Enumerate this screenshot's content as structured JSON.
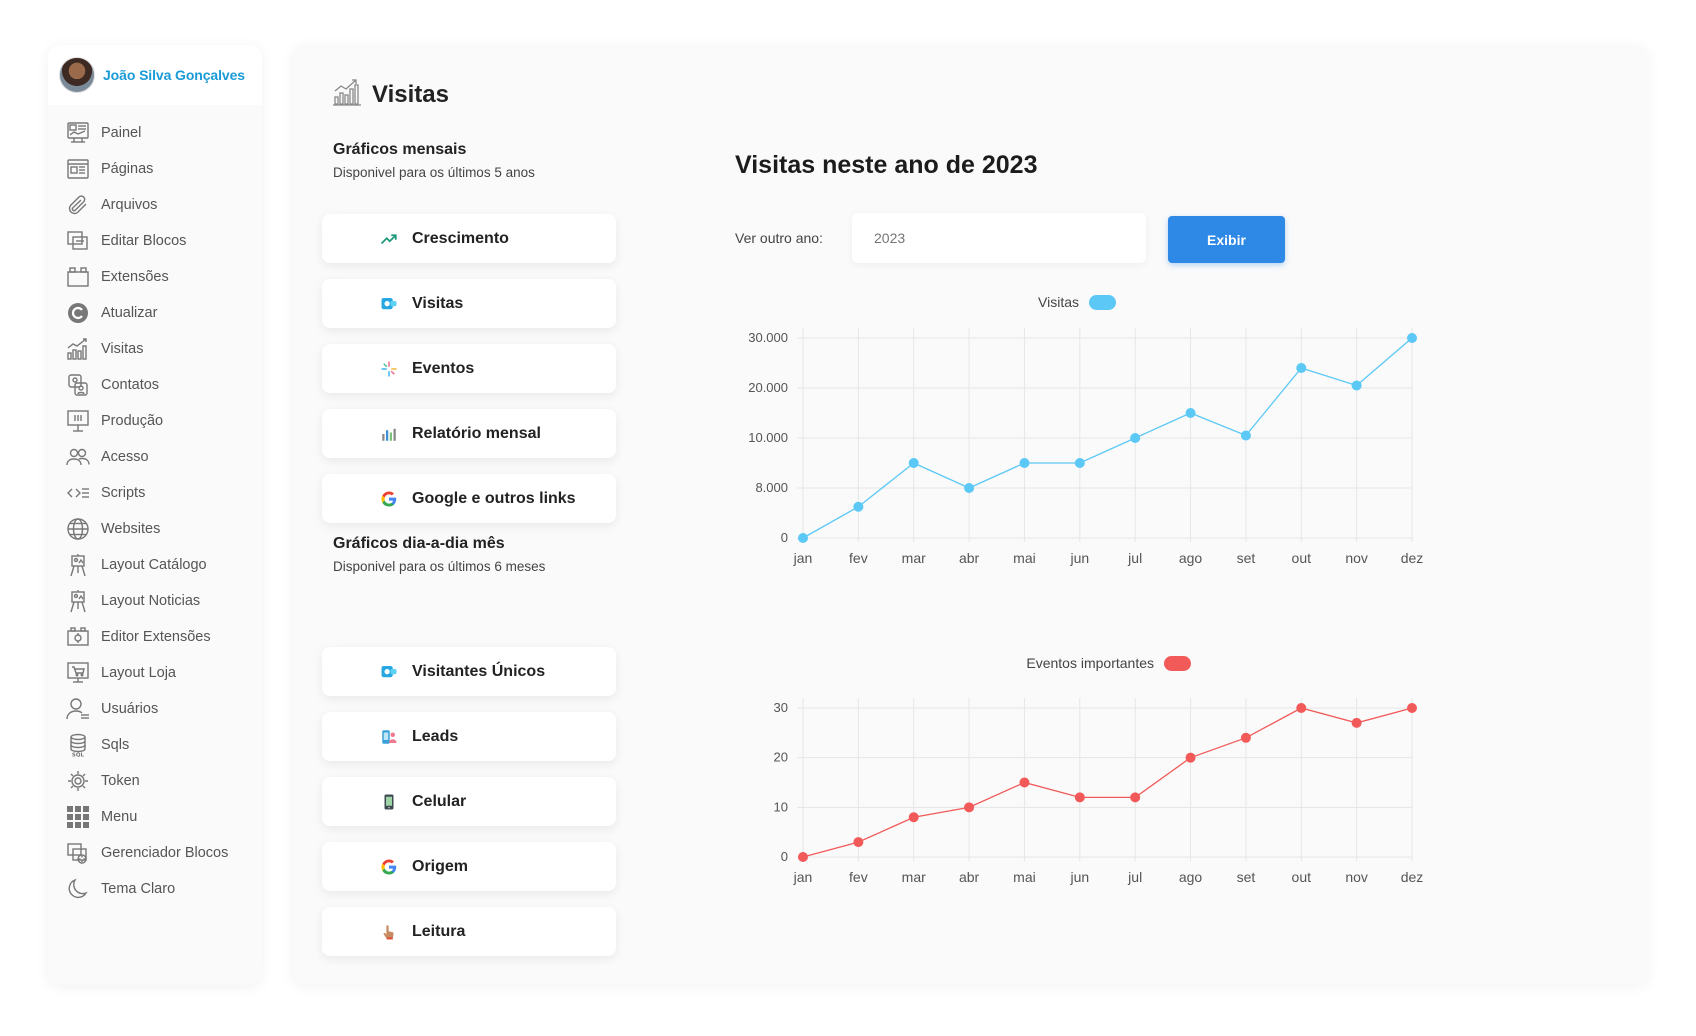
{
  "user": {
    "name": "João Silva Gonçalves"
  },
  "sidebar": {
    "items": [
      {
        "label": "Painel",
        "icon": "dashboard-icon"
      },
      {
        "label": "Páginas",
        "icon": "pages-icon"
      },
      {
        "label": "Arquivos",
        "icon": "paperclip-icon"
      },
      {
        "label": "Editar Blocos",
        "icon": "blocks-icon"
      },
      {
        "label": "Extensões",
        "icon": "extensions-icon"
      },
      {
        "label": "Atualizar",
        "icon": "update-icon"
      },
      {
        "label": "Visitas",
        "icon": "bar-chart-icon"
      },
      {
        "label": "Contatos",
        "icon": "contacts-icon"
      },
      {
        "label": "Produção",
        "icon": "production-icon"
      },
      {
        "label": "Acesso",
        "icon": "users-group-icon"
      },
      {
        "label": "Scripts",
        "icon": "code-icon"
      },
      {
        "label": "Websites",
        "icon": "globe-icon"
      },
      {
        "label": "Layout Catálogo",
        "icon": "easel-icon"
      },
      {
        "label": "Layout Noticias",
        "icon": "easel-icon"
      },
      {
        "label": "Editor Extensões",
        "icon": "editor-extensions-icon"
      },
      {
        "label": "Layout Loja",
        "icon": "shop-icon"
      },
      {
        "label": "Usuários",
        "icon": "user-icon"
      },
      {
        "label": "Sqls",
        "icon": "database-icon"
      },
      {
        "label": "Token",
        "icon": "token-icon"
      },
      {
        "label": "Menu",
        "icon": "grid-icon"
      },
      {
        "label": "Gerenciador Blocos",
        "icon": "blocks-manager-icon"
      },
      {
        "label": "Tema Claro",
        "icon": "moon-icon"
      }
    ]
  },
  "page": {
    "title": "Visitas"
  },
  "monthly": {
    "title": "Gráficos mensais",
    "subtitle": "Disponivel para os últimos 5 anos",
    "buttons": [
      {
        "label": "Crescimento",
        "icon": "trending-up-icon"
      },
      {
        "label": "Visitas",
        "icon": "visits-icon"
      },
      {
        "label": "Eventos",
        "icon": "sparkle-icon"
      },
      {
        "label": "Relatório mensal",
        "icon": "report-icon"
      },
      {
        "label": "Google e outros links",
        "icon": "google-icon"
      }
    ]
  },
  "daily": {
    "title": "Gráficos dia-a-dia mês",
    "subtitle": "Disponivel para os últimos 6 meses",
    "buttons": [
      {
        "label": "Visitantes Únicos",
        "icon": "visits-icon"
      },
      {
        "label": "Leads",
        "icon": "leads-icon"
      },
      {
        "label": "Celular",
        "icon": "phone-icon"
      },
      {
        "label": "Origem",
        "icon": "google-icon"
      },
      {
        "label": "Leitura",
        "icon": "pointer-icon"
      }
    ]
  },
  "charts_panel": {
    "heading": "Visitas neste ano de 2023",
    "year_label": "Ver outro ano:",
    "year_placeholder": "2023",
    "button_label": "Exibir"
  },
  "chart_data": [
    {
      "type": "line",
      "legend": "Visitas",
      "color": "#5bc8f5",
      "categories": [
        "jan",
        "fev",
        "mar",
        "abr",
        "mai",
        "jun",
        "jul",
        "ago",
        "set",
        "out",
        "nov",
        "dez"
      ],
      "yticks": [
        "0",
        "8.000",
        "10.000",
        "20.000",
        "30.000"
      ],
      "tick_values": [
        0,
        8000,
        10000,
        20000,
        30000
      ],
      "values": [
        0,
        5000,
        9000,
        8000,
        9000,
        9000,
        10000,
        15000,
        10500,
        24000,
        20500,
        30000
      ],
      "grid": true,
      "legend_position": "top-center"
    },
    {
      "type": "line",
      "legend": "Eventos importantes",
      "color": "#f25a5a",
      "categories": [
        "jan",
        "fev",
        "mar",
        "abr",
        "mai",
        "jun",
        "jul",
        "ago",
        "set",
        "out",
        "nov",
        "dez"
      ],
      "yticks": [
        "0",
        "10",
        "20",
        "30"
      ],
      "tick_values": [
        0,
        10,
        20,
        30
      ],
      "values": [
        0,
        3,
        8,
        10,
        15,
        12,
        12,
        20,
        24,
        30,
        27,
        30
      ],
      "grid": true,
      "legend_position": "top-center"
    }
  ]
}
